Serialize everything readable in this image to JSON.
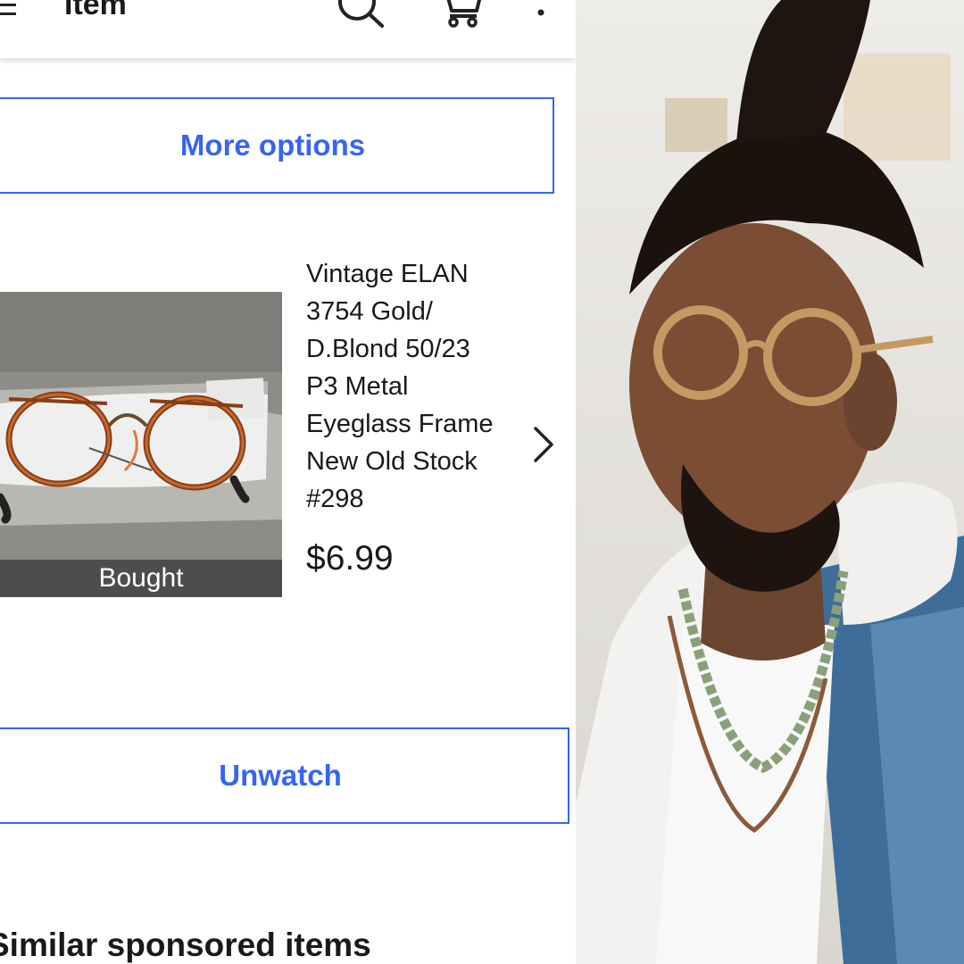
{
  "header": {
    "title": "Item",
    "icons": [
      "menu-icon",
      "search-icon",
      "cart-icon",
      "more-vertical-icon"
    ]
  },
  "more_options_label": "More options",
  "item": {
    "title_lines": [
      "Vintage ELAN",
      "3754 Gold/",
      "D.Blond 50/23",
      "P3 Metal",
      "Eyeglass Frame",
      "New Old Stock",
      "#298"
    ],
    "price": "$6.99",
    "thumbnail_badge": "Bought"
  },
  "unwatch_label": "Unwatch",
  "section_title": "Similar sponsored items",
  "colors": {
    "accent": "#3665f3",
    "text": "#191919",
    "badge_bg": "#4d4d4d"
  }
}
